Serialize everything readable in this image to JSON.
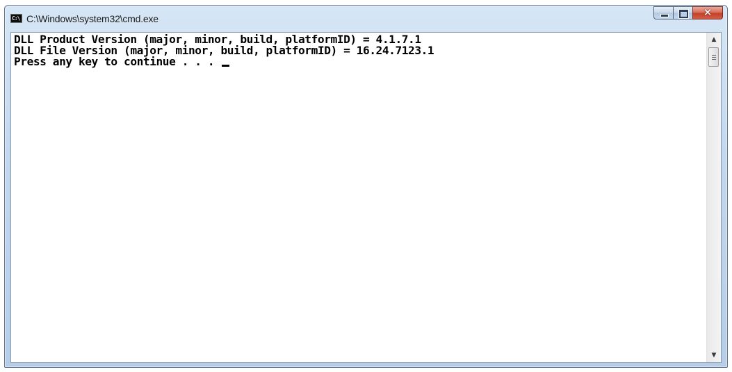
{
  "window": {
    "title": "C:\\Windows\\system32\\cmd.exe",
    "icon": "cmd-icon",
    "icon_text": "C:\\",
    "controls": {
      "minimize_icon": "minimize-icon",
      "maximize_icon": "maximize-icon",
      "close_icon": "close-icon",
      "close_glyph": "✕"
    }
  },
  "console": {
    "lines": [
      "DLL Product Version (major, minor, build, platformID) = 4.1.7.1",
      "DLL File Version (major, minor, build, platformID) = 16.24.7123.1",
      "Press any key to continue . . . "
    ],
    "text_color": "#000000",
    "background_color": "#ffffff"
  },
  "scrollbar": {
    "up_arrow": "▲",
    "down_arrow": "▼"
  },
  "colors": {
    "close_button": "#c3412a",
    "frame": "#c3d8ee"
  }
}
